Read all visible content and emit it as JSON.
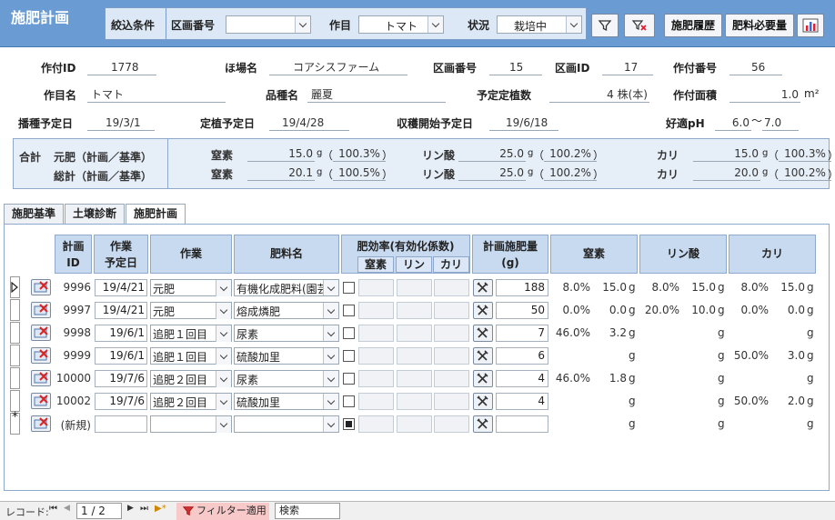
{
  "header": {
    "title": "施肥計画",
    "filter_label": "絞込条件",
    "plot_label": "区画番号",
    "plot_value": "",
    "crop_label": "作目",
    "crop_value": "トマト",
    "status_label": "状況",
    "status_value": "栽培中",
    "history_button": "施肥履歴",
    "required_button": "肥料必要量"
  },
  "info": {
    "row1": [
      {
        "label": "作付ID",
        "value": "1778"
      },
      {
        "label": "ほ場名",
        "value": "コアシスファーム"
      },
      {
        "label": "区画番号",
        "value": "15"
      },
      {
        "label": "区画ID",
        "value": "17"
      },
      {
        "label": "作付番号",
        "value": "56"
      }
    ],
    "row2": [
      {
        "label": "作目名",
        "value": "トマト"
      },
      {
        "label": "品種名",
        "value": "麗夏"
      },
      {
        "label": "予定定植数",
        "value": "4 株(本)"
      },
      {
        "label": "作付面積",
        "value": "1.0",
        "unit": "m²"
      }
    ],
    "row3": [
      {
        "label": "播種予定日",
        "value": "19/3/1"
      },
      {
        "label": "定植予定日",
        "value": "19/4/28"
      },
      {
        "label": "収穫開始予定日",
        "value": "19/6/18"
      },
      {
        "label": "好適pH",
        "value": "6.0",
        "sep": "〜",
        "value2": "7.0"
      }
    ]
  },
  "totals": {
    "sum_label": "合計",
    "rows": [
      {
        "label": "元肥（計画／基準）",
        "n_label": "窒素",
        "n_val": "15.0",
        "n_pct": "100.3%",
        "p_label": "リン酸",
        "p_val": "25.0",
        "p_pct": "100.2%",
        "k_label": "カリ",
        "k_val": "15.0",
        "k_pct": "100.3%"
      },
      {
        "label": "総計（計画／基準）",
        "n_label": "窒素",
        "n_val": "20.1",
        "n_pct": "100.5%",
        "p_label": "リン酸",
        "p_val": "25.0",
        "p_pct": "100.2%",
        "k_label": "カリ",
        "k_val": "20.0",
        "k_pct": "100.2%"
      }
    ],
    "unit": "g",
    "paren_open": "（",
    "paren_close": "）"
  },
  "tabs": [
    {
      "label": "施肥基準"
    },
    {
      "label": "土壌診断"
    },
    {
      "label": "施肥計画"
    }
  ],
  "grid": {
    "headers": {
      "plan_id": "計画\nID",
      "work_date": "作業\n予定日",
      "work": "作業",
      "fert": "肥料名",
      "eff": "肥効率(有効化係数)",
      "eff_n": "窒素",
      "eff_p": "リン",
      "eff_k": "カリ",
      "amount": "計画施肥量\n(g)",
      "n": "窒素",
      "p": "リン酸",
      "k": "カリ"
    },
    "rows": [
      {
        "id": "9996",
        "date": "19/4/21",
        "work": "元肥",
        "fert": "有機化成肥料(園芸",
        "amount": "188",
        "n_pct": "8.0%",
        "n_g": "15.0",
        "p_pct": "8.0%",
        "p_g": "15.0",
        "k_pct": "8.0%",
        "k_g": "15.0",
        "checked": false
      },
      {
        "id": "9997",
        "date": "19/4/21",
        "work": "元肥",
        "fert": "熔成燐肥",
        "amount": "50",
        "n_pct": "0.0%",
        "n_g": "0.0",
        "p_pct": "20.0%",
        "p_g": "10.0",
        "k_pct": "0.0%",
        "k_g": "0.0",
        "checked": false
      },
      {
        "id": "9998",
        "date": "19/6/1",
        "work": "追肥１回目",
        "fert": "尿素",
        "amount": "7",
        "n_pct": "46.0%",
        "n_g": "3.2",
        "p_pct": "",
        "p_g": "",
        "k_pct": "",
        "k_g": "",
        "checked": false
      },
      {
        "id": "9999",
        "date": "19/6/1",
        "work": "追肥１回目",
        "fert": "硫酸加里",
        "amount": "6",
        "n_pct": "",
        "n_g": "",
        "p_pct": "",
        "p_g": "",
        "k_pct": "50.0%",
        "k_g": "3.0",
        "checked": false
      },
      {
        "id": "10000",
        "date": "19/7/6",
        "work": "追肥２回目",
        "fert": "尿素",
        "amount": "4",
        "n_pct": "46.0%",
        "n_g": "1.8",
        "p_pct": "",
        "p_g": "",
        "k_pct": "",
        "k_g": "",
        "checked": false
      },
      {
        "id": "10002",
        "date": "19/7/6",
        "work": "追肥２回目",
        "fert": "硫酸加里",
        "amount": "4",
        "n_pct": "",
        "n_g": "",
        "p_pct": "",
        "p_g": "",
        "k_pct": "50.0%",
        "k_g": "2.0",
        "checked": false
      },
      {
        "id": "(新規)",
        "date": "",
        "work": "",
        "fert": "",
        "amount": "",
        "n_pct": "",
        "n_g": "",
        "p_pct": "",
        "p_g": "",
        "k_pct": "",
        "k_g": "",
        "checked": true
      }
    ],
    "unit": "g",
    "new_marker": "*"
  },
  "statusbar": {
    "record_label": "レコード:",
    "record_value": "1 / 2",
    "filter_label": "フィルター適用",
    "search_label": "検索"
  },
  "colors": {
    "header_bg": "#6b9bd3",
    "panel_bg": "#dce8f5",
    "grid_header": "#c8daf0",
    "filter_active": "#f8c9c9"
  }
}
